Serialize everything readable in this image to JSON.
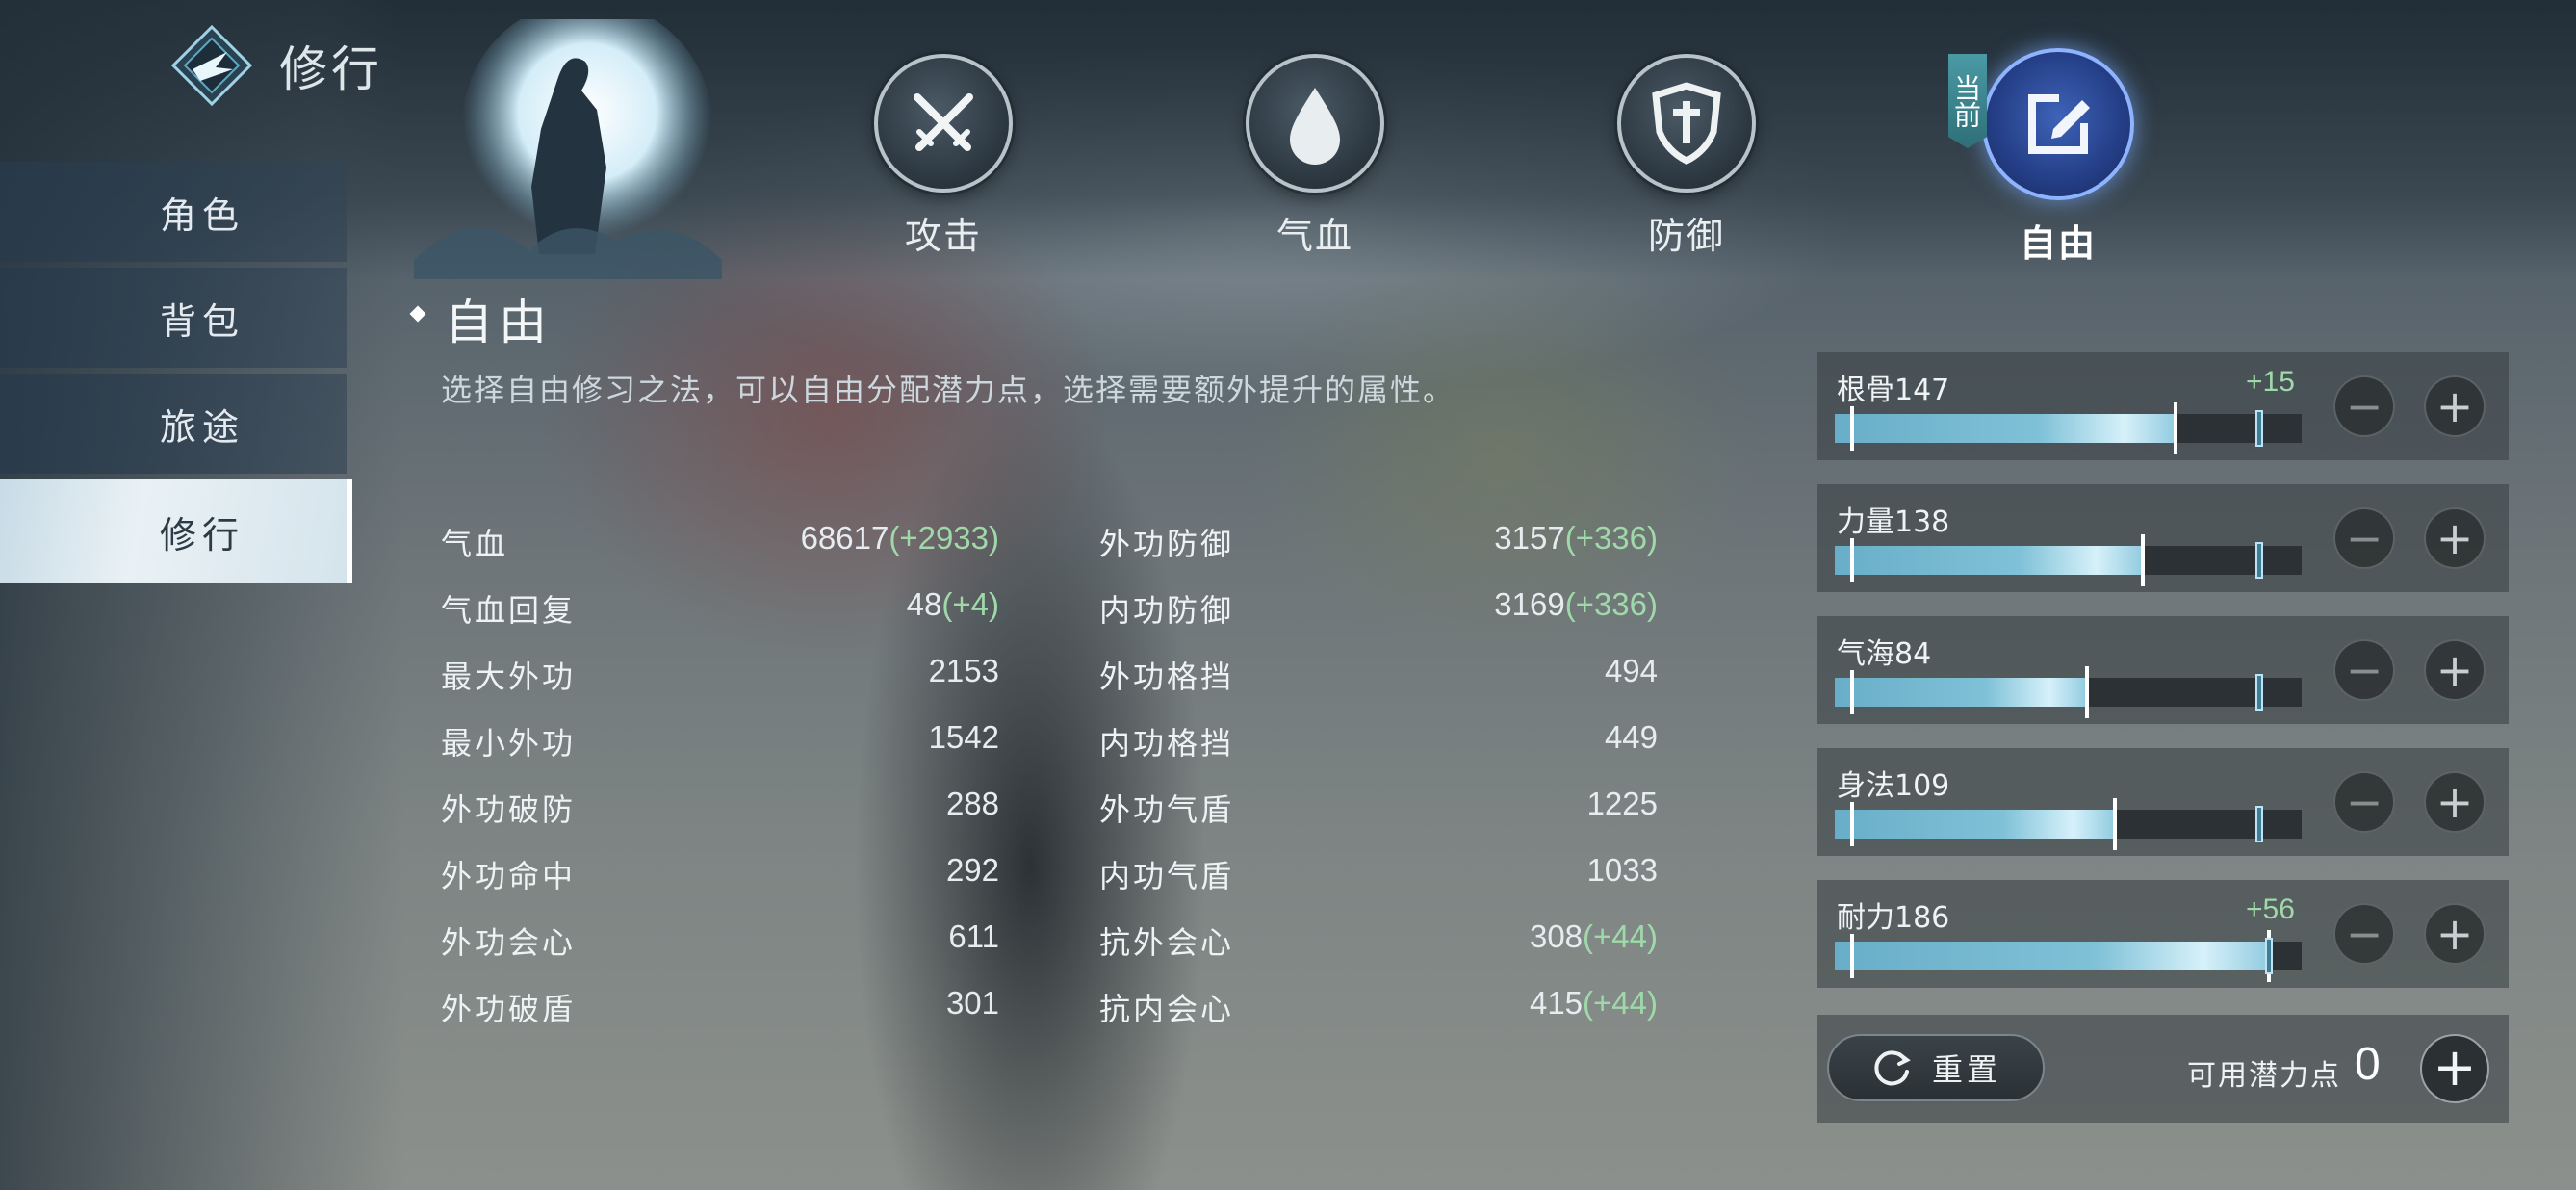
{
  "header": {
    "title": "修行"
  },
  "sidebar": {
    "items": [
      {
        "label": "角色"
      },
      {
        "label": "背包"
      },
      {
        "label": "旅途"
      },
      {
        "label": "修行"
      }
    ],
    "active_index": 3
  },
  "tabs": [
    {
      "label": "攻击",
      "icon": "crossed-swords-icon"
    },
    {
      "label": "气血",
      "icon": "blood-drop-icon"
    },
    {
      "label": "防御",
      "icon": "shield-icon"
    },
    {
      "label": "自由",
      "icon": "edit-icon"
    }
  ],
  "current_badge": "当前",
  "section": {
    "title": "自由",
    "description": "选择自由修习之法，可以自由分配潜力点，选择需要额外提升的属性。"
  },
  "stats_left": [
    {
      "name": "气血",
      "value": "68617",
      "bonus": "(+2933)"
    },
    {
      "name": "气血回复",
      "value": "48",
      "bonus": "(+4)"
    },
    {
      "name": "最大外功",
      "value": "2153",
      "bonus": ""
    },
    {
      "name": "最小外功",
      "value": "1542",
      "bonus": ""
    },
    {
      "name": "外功破防",
      "value": "288",
      "bonus": ""
    },
    {
      "name": "外功命中",
      "value": "292",
      "bonus": ""
    },
    {
      "name": "外功会心",
      "value": "611",
      "bonus": ""
    },
    {
      "name": "外功破盾",
      "value": "301",
      "bonus": ""
    }
  ],
  "stats_right": [
    {
      "name": "外功防御",
      "value": "3157",
      "bonus": "(+336)"
    },
    {
      "name": "内功防御",
      "value": "3169",
      "bonus": "(+336)"
    },
    {
      "name": "外功格挡",
      "value": "494",
      "bonus": ""
    },
    {
      "name": "内功格挡",
      "value": "449",
      "bonus": ""
    },
    {
      "name": "外功气盾",
      "value": "1225",
      "bonus": ""
    },
    {
      "name": "内功气盾",
      "value": "1033",
      "bonus": ""
    },
    {
      "name": "抗外会心",
      "value": "308",
      "bonus": "(+44)"
    },
    {
      "name": "抗内会心",
      "value": "415",
      "bonus": "(+44)"
    }
  ],
  "attributes": [
    {
      "name": "根骨147",
      "plus": "+15",
      "fill": 0.73,
      "marker": 0.91
    },
    {
      "name": "力量138",
      "plus": "",
      "fill": 0.66,
      "marker": 0.91
    },
    {
      "name": "气海84",
      "plus": "",
      "fill": 0.54,
      "marker": 0.91
    },
    {
      "name": "身法109",
      "plus": "",
      "fill": 0.6,
      "marker": 0.91
    },
    {
      "name": "耐力186",
      "plus": "+56",
      "fill": 0.93,
      "marker": 0.93
    }
  ],
  "buttons": {
    "minus": "−",
    "plus": "+"
  },
  "footer": {
    "reset_label": "重置",
    "points_label": "可用潜力点",
    "points_value": "0"
  },
  "colors": {
    "bonus": "#9fd9a9",
    "bar": "#69aec8",
    "current_tab": "#2f4fa0"
  }
}
